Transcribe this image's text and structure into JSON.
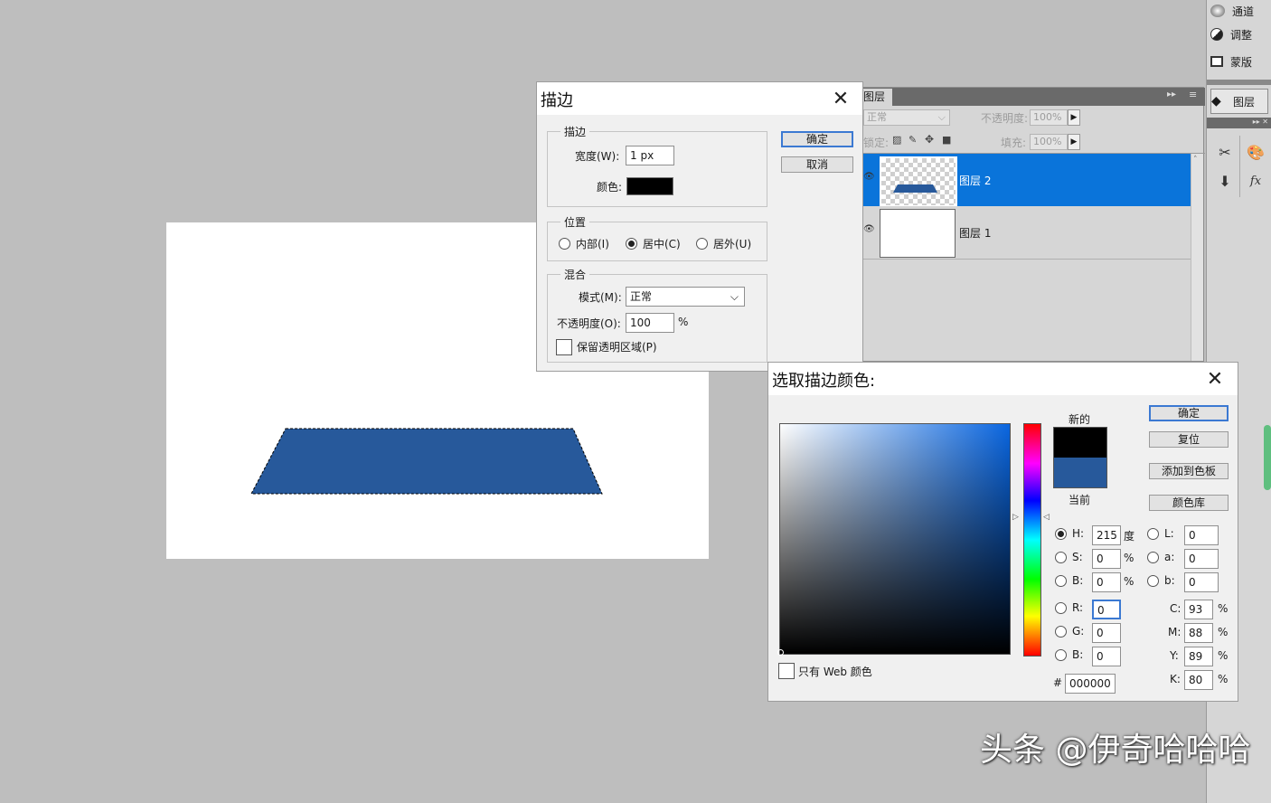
{
  "dock": {
    "items": [
      {
        "label": "通道",
        "icon": "channels-icon"
      },
      {
        "label": "调整",
        "icon": "adjustments-icon"
      },
      {
        "label": "蒙版",
        "icon": "masks-icon"
      }
    ],
    "layers_button": "图层",
    "tools": [
      "scissors-icon",
      "palette-icon",
      "stamp-icon",
      "fx-icon"
    ]
  },
  "layers_panel": {
    "tab": "图层",
    "blend_mode": "正常",
    "opacity_label": "不透明度:",
    "opacity_value": "100%",
    "lock_label": "锁定:",
    "fill_label": "填充:",
    "fill_value": "100%",
    "layers": [
      {
        "name": "图层 2",
        "selected": true
      },
      {
        "name": "图层 1",
        "selected": false
      }
    ]
  },
  "stroke_dialog": {
    "title": "描边",
    "ok": "确定",
    "cancel": "取消",
    "stroke_group": "描边",
    "width_label": "宽度(W):",
    "width_value": "1 px",
    "color_label": "颜色:",
    "stroke_color": "#000000",
    "position_group": "位置",
    "position_options": [
      {
        "label": "内部(I)",
        "checked": false
      },
      {
        "label": "居中(C)",
        "checked": true
      },
      {
        "label": "居外(U)",
        "checked": false
      }
    ],
    "blend_group": "混合",
    "mode_label": "模式(M):",
    "mode_value": "正常",
    "opacity_label": "不透明度(O):",
    "opacity_value": "100",
    "opacity_unit": "%",
    "preserve_label": "保留透明区域(P)"
  },
  "color_picker": {
    "title": "选取描边颜色:",
    "ok": "确定",
    "reset": "复位",
    "add_swatch": "添加到色板",
    "color_libraries": "颜色库",
    "new_label": "新的",
    "current_label": "当前",
    "new_color": "#000000",
    "current_color": "#27599b",
    "web_only": "只有 Web 颜色",
    "hsb": [
      {
        "label": "H:",
        "value": "215",
        "unit": "度",
        "checked": true
      },
      {
        "label": "S:",
        "value": "0",
        "unit": "%",
        "checked": false
      },
      {
        "label": "B:",
        "value": "0",
        "unit": "%",
        "checked": false
      }
    ],
    "rgb": [
      {
        "label": "R:",
        "value": "0"
      },
      {
        "label": "G:",
        "value": "0"
      },
      {
        "label": "B:",
        "value": "0"
      }
    ],
    "lab": [
      {
        "label": "L:",
        "value": "0"
      },
      {
        "label": "a:",
        "value": "0"
      },
      {
        "label": "b:",
        "value": "0"
      }
    ],
    "cmyk": [
      {
        "label": "C:",
        "value": "93",
        "unit": "%"
      },
      {
        "label": "M:",
        "value": "88",
        "unit": "%"
      },
      {
        "label": "Y:",
        "value": "89",
        "unit": "%"
      },
      {
        "label": "K:",
        "value": "80",
        "unit": "%"
      }
    ],
    "hex_label": "#",
    "hex_value": "000000"
  },
  "canvas": {
    "shape_color": "#27599b"
  },
  "watermark": "头条 @伊奇哈哈哈"
}
